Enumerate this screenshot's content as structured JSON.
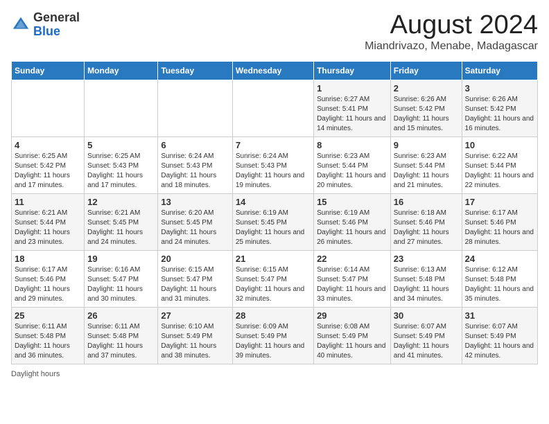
{
  "header": {
    "logo_general": "General",
    "logo_blue": "Blue",
    "title": "August 2024",
    "subtitle": "Miandrivazo, Menabe, Madagascar"
  },
  "weekdays": [
    "Sunday",
    "Monday",
    "Tuesday",
    "Wednesday",
    "Thursday",
    "Friday",
    "Saturday"
  ],
  "weeks": [
    [
      {
        "day": "",
        "info": ""
      },
      {
        "day": "",
        "info": ""
      },
      {
        "day": "",
        "info": ""
      },
      {
        "day": "",
        "info": ""
      },
      {
        "day": "1",
        "info": "Sunrise: 6:27 AM\nSunset: 5:41 PM\nDaylight: 11 hours and 14 minutes."
      },
      {
        "day": "2",
        "info": "Sunrise: 6:26 AM\nSunset: 5:42 PM\nDaylight: 11 hours and 15 minutes."
      },
      {
        "day": "3",
        "info": "Sunrise: 6:26 AM\nSunset: 5:42 PM\nDaylight: 11 hours and 16 minutes."
      }
    ],
    [
      {
        "day": "4",
        "info": "Sunrise: 6:25 AM\nSunset: 5:42 PM\nDaylight: 11 hours and 17 minutes."
      },
      {
        "day": "5",
        "info": "Sunrise: 6:25 AM\nSunset: 5:43 PM\nDaylight: 11 hours and 17 minutes."
      },
      {
        "day": "6",
        "info": "Sunrise: 6:24 AM\nSunset: 5:43 PM\nDaylight: 11 hours and 18 minutes."
      },
      {
        "day": "7",
        "info": "Sunrise: 6:24 AM\nSunset: 5:43 PM\nDaylight: 11 hours and 19 minutes."
      },
      {
        "day": "8",
        "info": "Sunrise: 6:23 AM\nSunset: 5:44 PM\nDaylight: 11 hours and 20 minutes."
      },
      {
        "day": "9",
        "info": "Sunrise: 6:23 AM\nSunset: 5:44 PM\nDaylight: 11 hours and 21 minutes."
      },
      {
        "day": "10",
        "info": "Sunrise: 6:22 AM\nSunset: 5:44 PM\nDaylight: 11 hours and 22 minutes."
      }
    ],
    [
      {
        "day": "11",
        "info": "Sunrise: 6:21 AM\nSunset: 5:44 PM\nDaylight: 11 hours and 23 minutes."
      },
      {
        "day": "12",
        "info": "Sunrise: 6:21 AM\nSunset: 5:45 PM\nDaylight: 11 hours and 24 minutes."
      },
      {
        "day": "13",
        "info": "Sunrise: 6:20 AM\nSunset: 5:45 PM\nDaylight: 11 hours and 24 minutes."
      },
      {
        "day": "14",
        "info": "Sunrise: 6:19 AM\nSunset: 5:45 PM\nDaylight: 11 hours and 25 minutes."
      },
      {
        "day": "15",
        "info": "Sunrise: 6:19 AM\nSunset: 5:46 PM\nDaylight: 11 hours and 26 minutes."
      },
      {
        "day": "16",
        "info": "Sunrise: 6:18 AM\nSunset: 5:46 PM\nDaylight: 11 hours and 27 minutes."
      },
      {
        "day": "17",
        "info": "Sunrise: 6:17 AM\nSunset: 5:46 PM\nDaylight: 11 hours and 28 minutes."
      }
    ],
    [
      {
        "day": "18",
        "info": "Sunrise: 6:17 AM\nSunset: 5:46 PM\nDaylight: 11 hours and 29 minutes."
      },
      {
        "day": "19",
        "info": "Sunrise: 6:16 AM\nSunset: 5:47 PM\nDaylight: 11 hours and 30 minutes."
      },
      {
        "day": "20",
        "info": "Sunrise: 6:15 AM\nSunset: 5:47 PM\nDaylight: 11 hours and 31 minutes."
      },
      {
        "day": "21",
        "info": "Sunrise: 6:15 AM\nSunset: 5:47 PM\nDaylight: 11 hours and 32 minutes."
      },
      {
        "day": "22",
        "info": "Sunrise: 6:14 AM\nSunset: 5:47 PM\nDaylight: 11 hours and 33 minutes."
      },
      {
        "day": "23",
        "info": "Sunrise: 6:13 AM\nSunset: 5:48 PM\nDaylight: 11 hours and 34 minutes."
      },
      {
        "day": "24",
        "info": "Sunrise: 6:12 AM\nSunset: 5:48 PM\nDaylight: 11 hours and 35 minutes."
      }
    ],
    [
      {
        "day": "25",
        "info": "Sunrise: 6:11 AM\nSunset: 5:48 PM\nDaylight: 11 hours and 36 minutes."
      },
      {
        "day": "26",
        "info": "Sunrise: 6:11 AM\nSunset: 5:48 PM\nDaylight: 11 hours and 37 minutes."
      },
      {
        "day": "27",
        "info": "Sunrise: 6:10 AM\nSunset: 5:49 PM\nDaylight: 11 hours and 38 minutes."
      },
      {
        "day": "28",
        "info": "Sunrise: 6:09 AM\nSunset: 5:49 PM\nDaylight: 11 hours and 39 minutes."
      },
      {
        "day": "29",
        "info": "Sunrise: 6:08 AM\nSunset: 5:49 PM\nDaylight: 11 hours and 40 minutes."
      },
      {
        "day": "30",
        "info": "Sunrise: 6:07 AM\nSunset: 5:49 PM\nDaylight: 11 hours and 41 minutes."
      },
      {
        "day": "31",
        "info": "Sunrise: 6:07 AM\nSunset: 5:49 PM\nDaylight: 11 hours and 42 minutes."
      }
    ]
  ],
  "footer": {
    "daylight_label": "Daylight hours"
  }
}
